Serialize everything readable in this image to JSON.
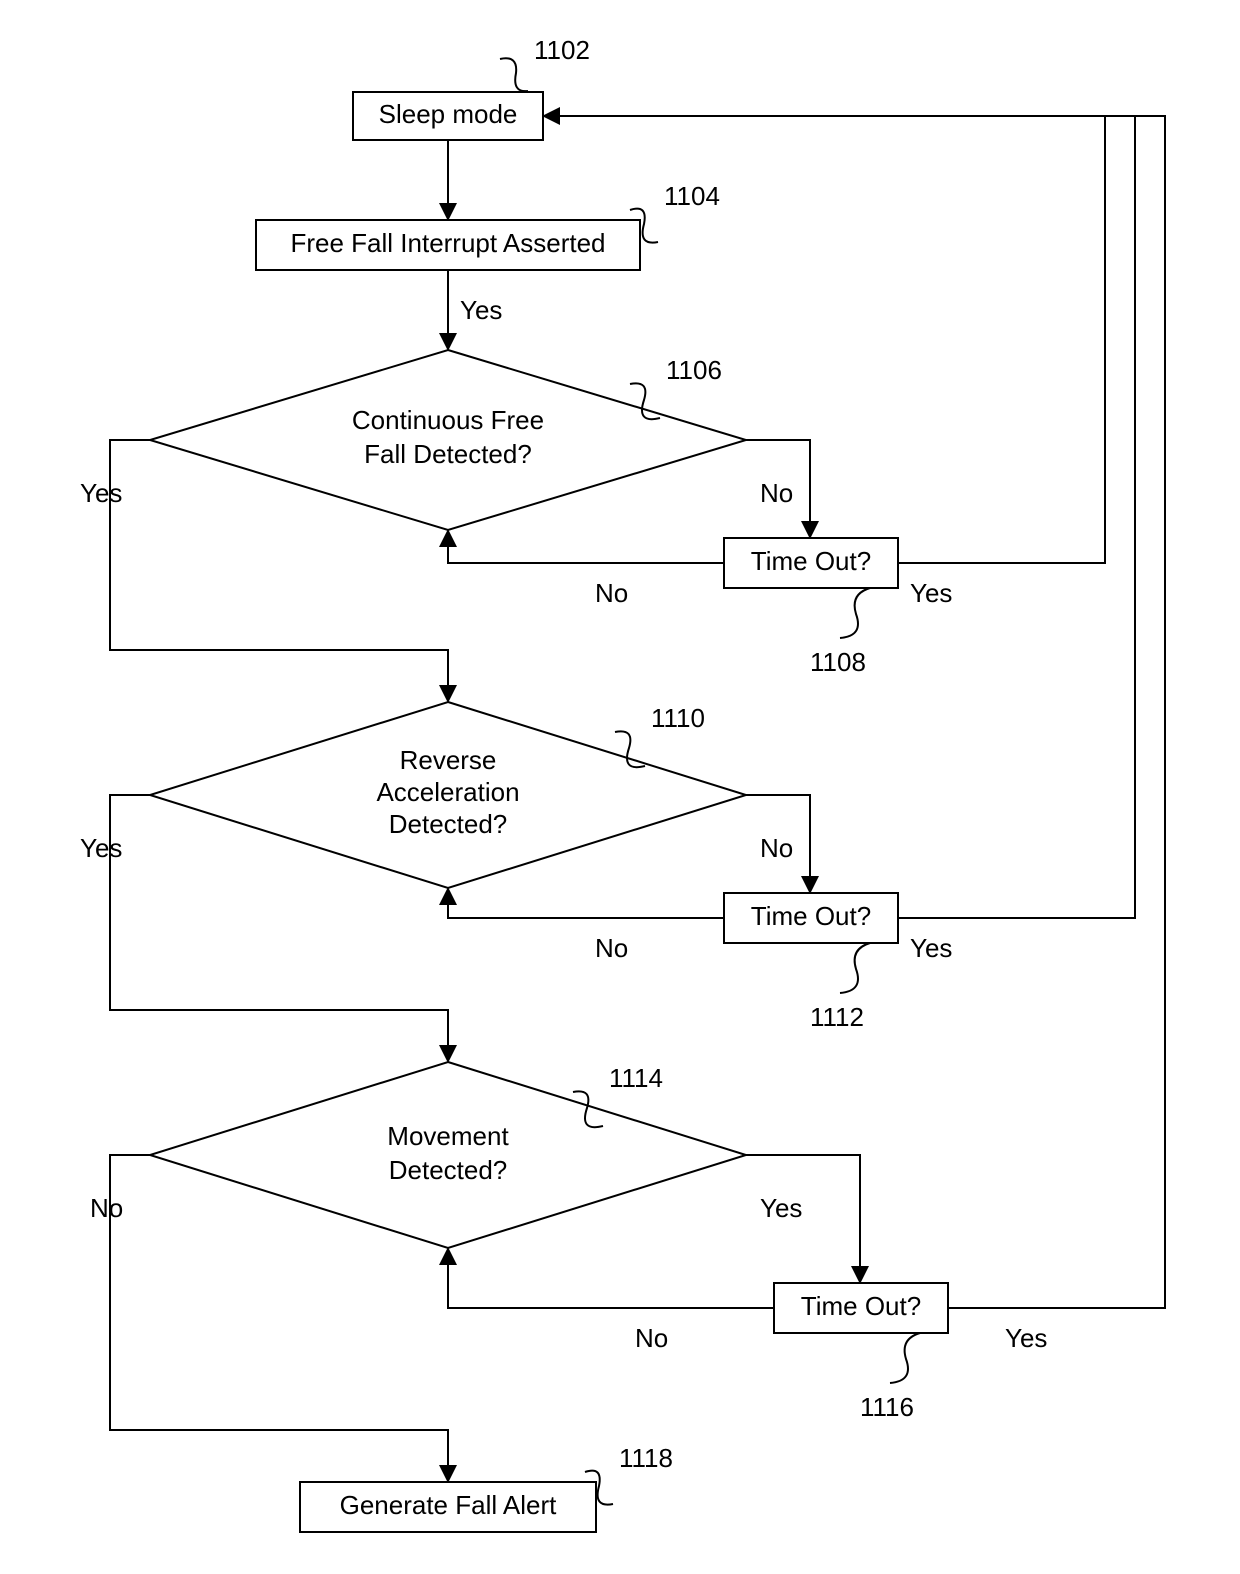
{
  "nodes": {
    "sleep": {
      "label": "Sleep mode",
      "ref": "1102"
    },
    "interrupt": {
      "label": "Free Fall Interrupt Asserted",
      "ref": "1104"
    },
    "freefall": {
      "line1": "Continuous Free",
      "line2": "Fall Detected?",
      "ref": "1106"
    },
    "timeout1": {
      "label": "Time Out?",
      "ref": "1108"
    },
    "reverse": {
      "line1": "Reverse",
      "line2": "Acceleration",
      "line3": "Detected?",
      "ref": "1110"
    },
    "timeout2": {
      "label": "Time Out?",
      "ref": "1112"
    },
    "movement": {
      "line1": "Movement",
      "line2": "Detected?",
      "ref": "1114"
    },
    "timeout3": {
      "label": "Time Out?",
      "ref": "1116"
    },
    "alert": {
      "label": "Generate Fall Alert",
      "ref": "1118"
    }
  },
  "labels": {
    "yes": "Yes",
    "no": "No"
  }
}
